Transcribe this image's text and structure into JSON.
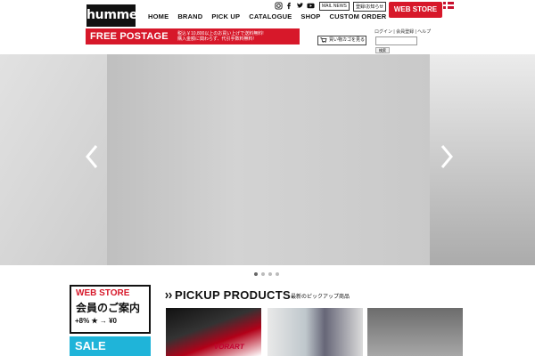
{
  "brand": {
    "logo_text": "hummel",
    "accent_red": "#d7182a",
    "accent_blue": "#1fb4d9"
  },
  "nav": {
    "items": [
      {
        "label": "HOME"
      },
      {
        "label": "BRAND"
      },
      {
        "label": "PICK UP"
      },
      {
        "label": "CATALOGUE"
      },
      {
        "label": "SHOP"
      },
      {
        "label": "CUSTOM ORDER"
      }
    ]
  },
  "header": {
    "mail_news": "MAIL NEWS",
    "register": "登録/お知らせ",
    "web_store": "WEB STORE",
    "flag_icon": "denmark-flag-icon",
    "social_icons": [
      "instagram-icon",
      "facebook-icon",
      "twitter-icon",
      "youtube-icon"
    ]
  },
  "promo": {
    "free_postage": "FREE POSTAGE",
    "line1": "税込￥10,800以上のお買い上げで送料無料!",
    "line2": "購入金額に関わらず、代引手数料無料!",
    "cart_label": "買い物カゴを見る",
    "links": "ログイン | 会員登録 | ヘルプ",
    "search_button": "検索"
  },
  "hero": {
    "slides": 4,
    "active_slide": 1
  },
  "banners": {
    "web_store_title": "WEB STORE",
    "web_store_sub": "会員のご案内",
    "web_store_row": "+8% ★ → ¥0",
    "sale": "SALE"
  },
  "pickup": {
    "title": "PICKUP PRODUCTS",
    "subtitle": "最新のピックアップ商品",
    "thumb1_text": "VORART"
  }
}
